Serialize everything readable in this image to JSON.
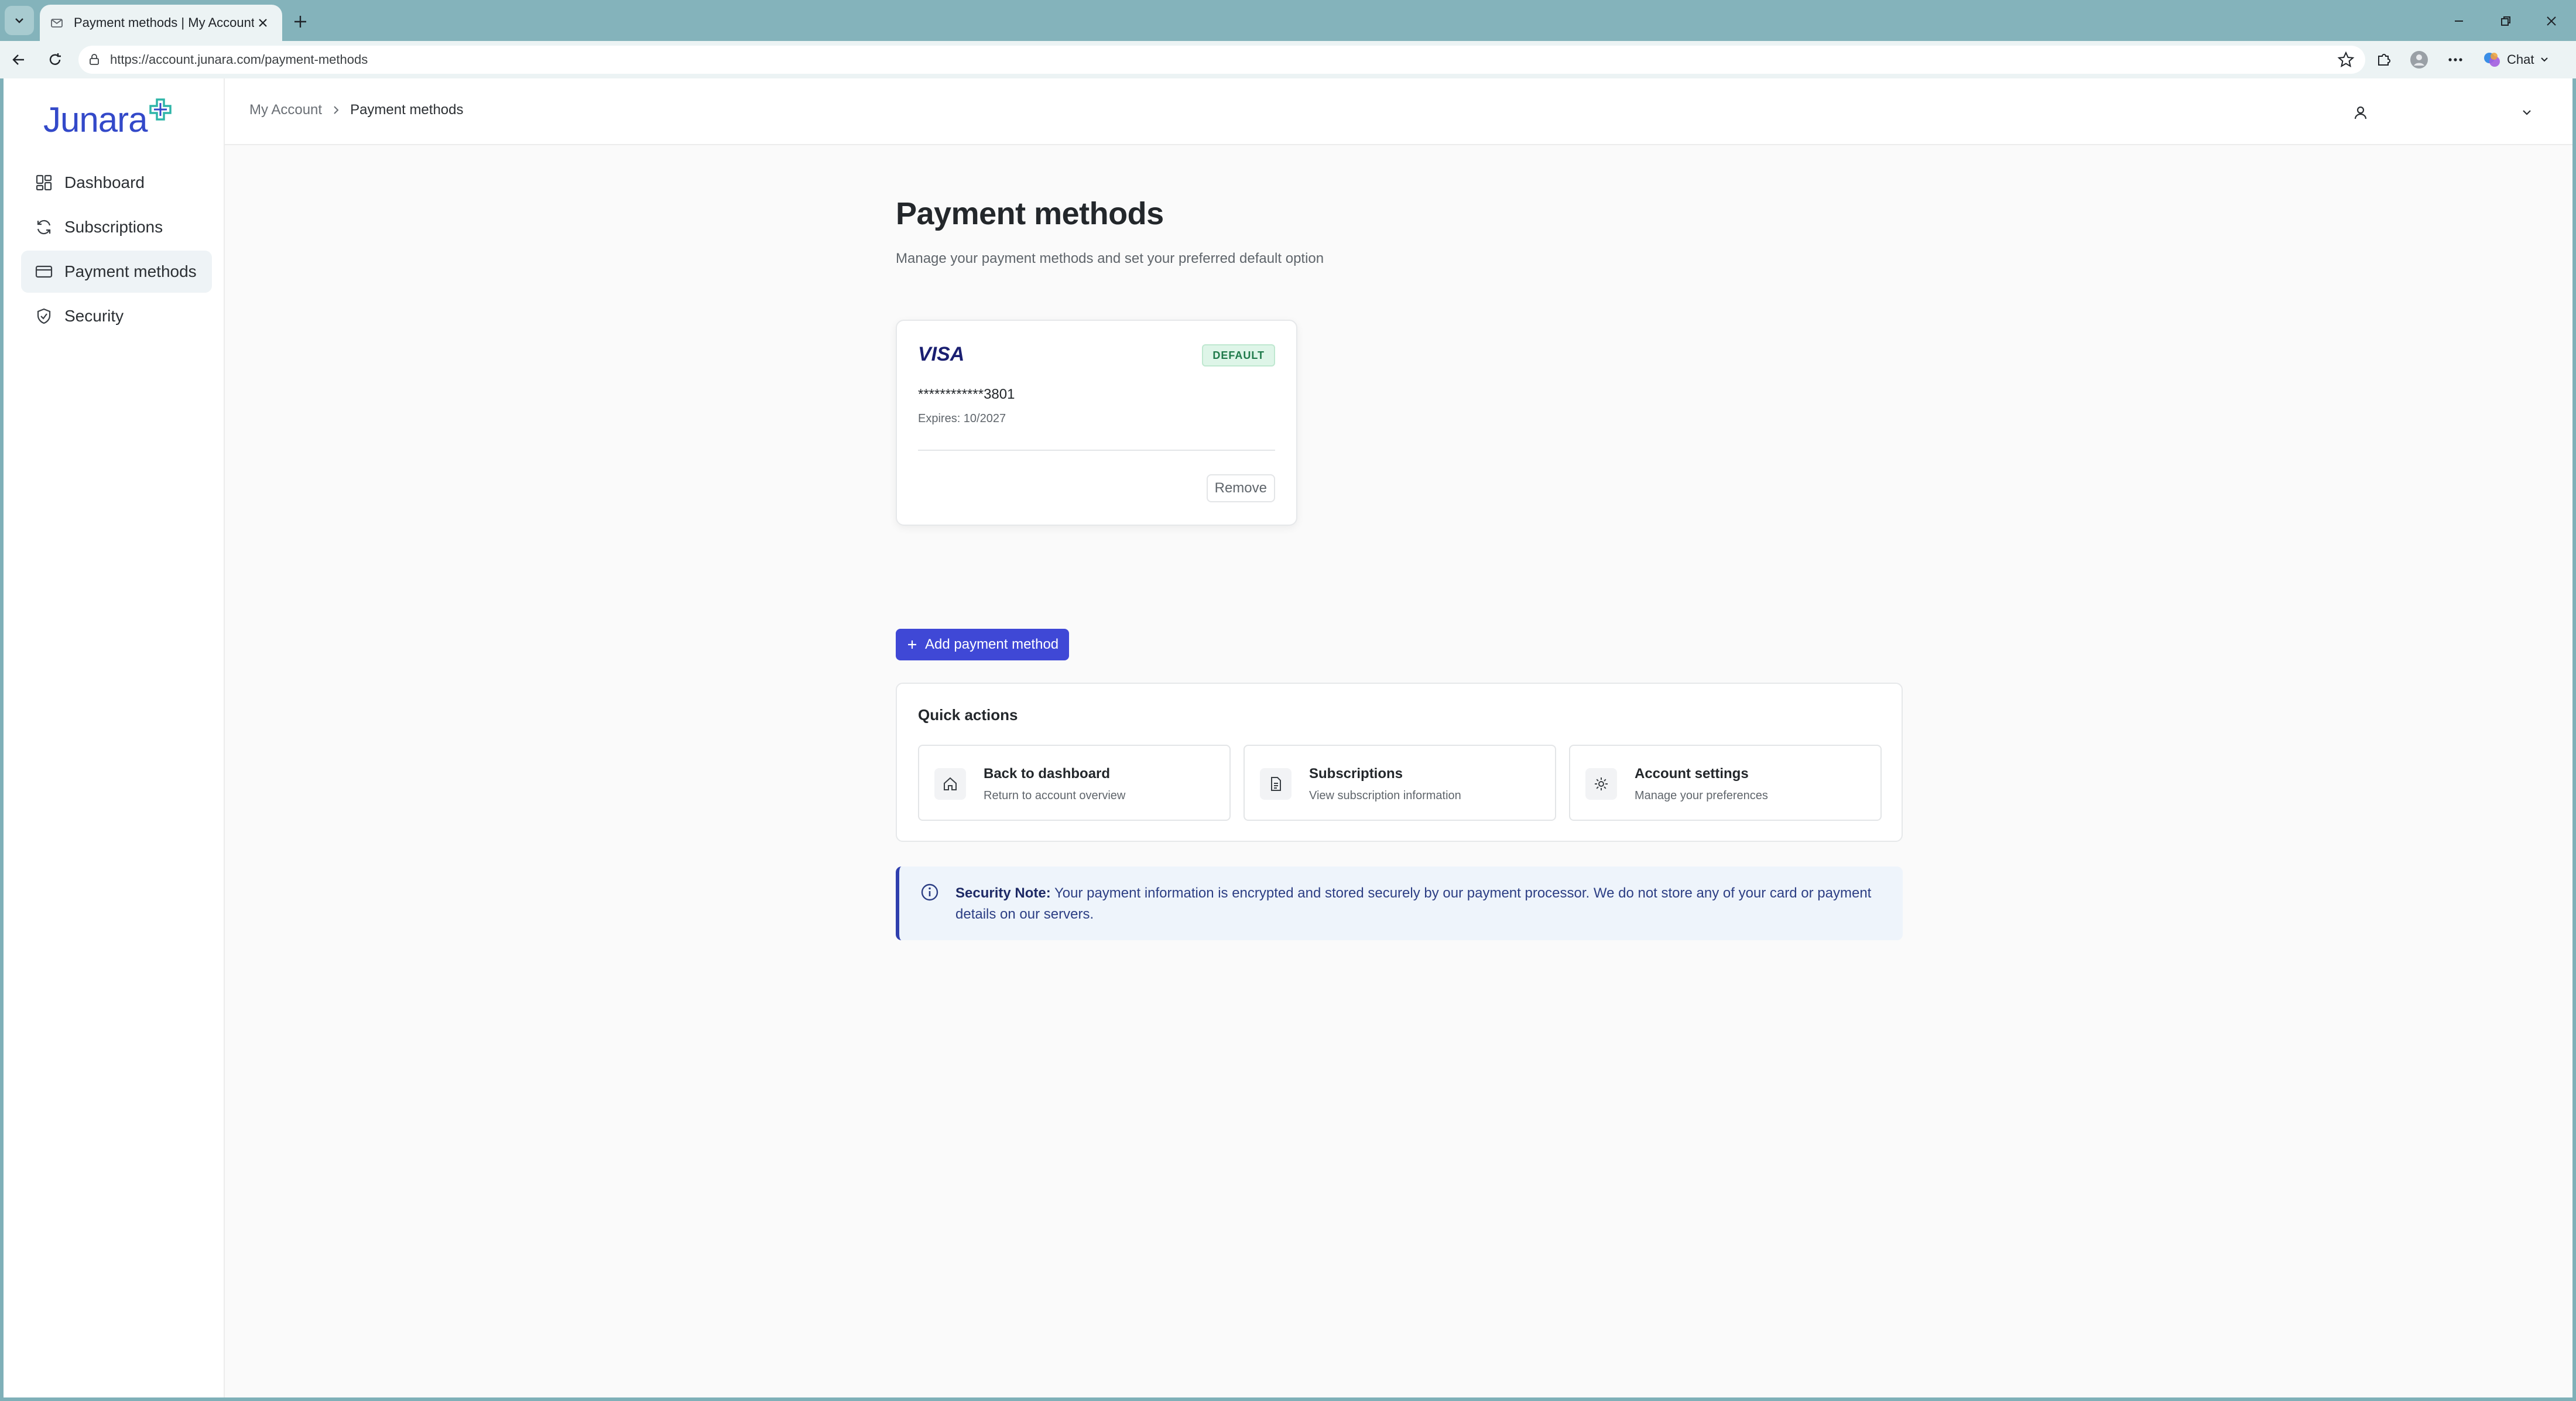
{
  "browser": {
    "tab_title": "Payment methods | My Account",
    "url": "https://account.junara.com/payment-methods",
    "chat_label": "Chat"
  },
  "brand": {
    "logo_text": "Junara"
  },
  "sidebar": {
    "items": [
      {
        "label": "Dashboard",
        "icon": "dashboard-grid-icon"
      },
      {
        "label": "Subscriptions",
        "icon": "refresh-icon"
      },
      {
        "label": "Payment methods",
        "icon": "credit-card-icon",
        "active": true
      },
      {
        "label": "Security",
        "icon": "shield-check-icon"
      }
    ]
  },
  "header": {
    "breadcrumb": {
      "parent": "My Account",
      "current": "Payment methods"
    }
  },
  "main": {
    "title": "Payment methods",
    "subtitle": "Manage your payment methods and set your preferred default option",
    "card": {
      "brand": "VISA",
      "badge": "DEFAULT",
      "number": "************3801",
      "expiry": "Expires: 10/2027",
      "remove_label": "Remove"
    },
    "add_button_label": "Add payment method",
    "quick_actions": {
      "title": "Quick actions",
      "items": [
        {
          "label": "Back to dashboard",
          "desc": "Return to account overview",
          "icon": "home-icon"
        },
        {
          "label": "Subscriptions",
          "desc": "View subscription information",
          "icon": "document-icon"
        },
        {
          "label": "Account settings",
          "desc": "Manage your preferences",
          "icon": "gear-icon"
        }
      ]
    },
    "security_note": {
      "title": "Security Note:",
      "body": "Your payment information is encrypted and stored securely by our payment processor. We do not store any of your card or payment details on our servers."
    }
  },
  "colors": {
    "accent": "#3f48d6",
    "brand": "#3349c9",
    "default_badge": "#1f7a4a",
    "note_border": "#2f3fae",
    "browser_frame": "#84b3bb"
  }
}
